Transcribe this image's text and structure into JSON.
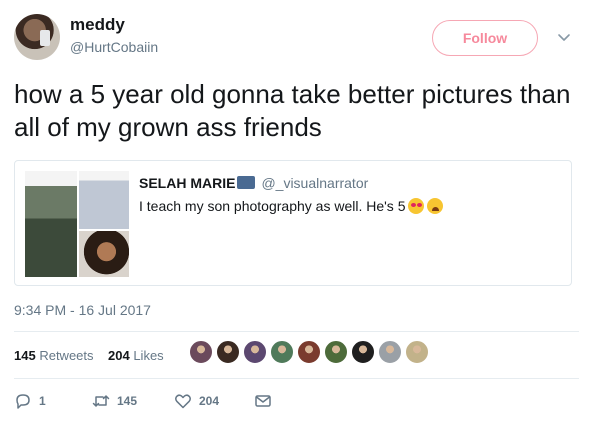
{
  "author": {
    "name": "meddy",
    "handle": "@HurtCobaiin",
    "avatar_icon": "user-avatar"
  },
  "follow_label": "Follow",
  "colors": {
    "follow_accent": "#f6899c",
    "text_primary": "#14171a",
    "text_secondary": "#657786",
    "border": "#e1e8ed"
  },
  "tweet_text": "how a 5 year old gonna take better pictures than all of my grown ass friends",
  "quoted_tweet": {
    "name": "SELAH MARIE",
    "badge_icon": "camera-emoji",
    "handle": "@_visualnarrator",
    "text": "I teach my son photography as well.  He's 5",
    "emojis": [
      "heart-eyes-emoji",
      "weary-face-emoji"
    ]
  },
  "timestamp": "9:34 PM - 16 Jul 2017",
  "stats": {
    "retweets_count": "145",
    "retweets_label": "Retweets",
    "likes_count": "204",
    "likes_label": "Likes"
  },
  "likers": [
    {
      "color": "#6b4a5c"
    },
    {
      "color": "#3a2a22"
    },
    {
      "color": "#5c4870"
    },
    {
      "color": "#4f7a5a"
    },
    {
      "color": "#7a3b2e"
    },
    {
      "color": "#4d6b3a"
    },
    {
      "color": "#1f1f1f"
    },
    {
      "color": "#9aa0a6"
    },
    {
      "color": "#c2b28a"
    }
  ],
  "actions": {
    "reply_count": "1",
    "retweet_count": "145",
    "like_count": "204"
  }
}
